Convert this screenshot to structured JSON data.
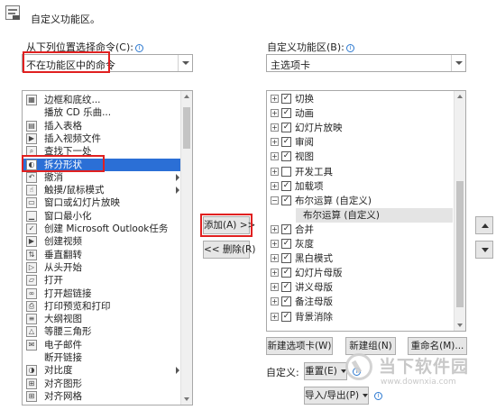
{
  "header": {
    "title": "自定义功能区。"
  },
  "left": {
    "label": "从下列位置选择命令(C):",
    "combo_value": "不在功能区中的命令",
    "commands": [
      {
        "label": "边框和底纹...",
        "icon": "borders-icon",
        "glyph": "▦"
      },
      {
        "label": "播放 CD 乐曲...",
        "icon": "blank-icon",
        "glyph": ""
      },
      {
        "label": "插入表格",
        "icon": "table-icon",
        "glyph": "▤"
      },
      {
        "label": "插入视频文件",
        "icon": "video-icon",
        "glyph": "▶"
      },
      {
        "label": "查找下一处",
        "icon": "find-icon",
        "glyph": "⌕"
      },
      {
        "label": "拆分形状",
        "icon": "split-shape-icon",
        "glyph": "◐",
        "selected": true
      },
      {
        "label": "撤消",
        "icon": "undo-icon",
        "glyph": "↶",
        "submenu": true
      },
      {
        "label": "触摸/鼠标模式",
        "icon": "touch-icon",
        "glyph": "☝",
        "submenu": true
      },
      {
        "label": "窗口或幻灯片放映",
        "icon": "window-icon",
        "glyph": "▭"
      },
      {
        "label": "窗口最小化",
        "icon": "minimize-icon",
        "glyph": "▁"
      },
      {
        "label": "创建 Microsoft Outlook任务",
        "icon": "outlook-icon",
        "glyph": "✓"
      },
      {
        "label": "创建视频",
        "icon": "create-video-icon",
        "glyph": "▶"
      },
      {
        "label": "垂直翻转",
        "icon": "flip-vertical-icon",
        "glyph": "⇅"
      },
      {
        "label": "从头开始",
        "icon": "from-start-icon",
        "glyph": "▷"
      },
      {
        "label": "打开",
        "icon": "open-folder-icon",
        "glyph": "▱"
      },
      {
        "label": "打开超链接",
        "icon": "hyperlink-icon",
        "glyph": "∞"
      },
      {
        "label": "打印预览和打印",
        "icon": "print-icon",
        "glyph": "⎙"
      },
      {
        "label": "大纲视图",
        "icon": "outline-icon",
        "glyph": "≡"
      },
      {
        "label": "等腰三角形",
        "icon": "triangle-icon",
        "glyph": "△"
      },
      {
        "label": "电子邮件",
        "icon": "email-icon",
        "glyph": "✉"
      },
      {
        "label": "断开链接",
        "icon": "blank-icon",
        "glyph": ""
      },
      {
        "label": "对比度",
        "icon": "contrast-icon",
        "glyph": "◑",
        "submenu": true
      },
      {
        "label": "对齐图形",
        "icon": "align-shape-icon",
        "glyph": "⊞"
      },
      {
        "label": "对齐网格",
        "icon": "align-grid-icon",
        "glyph": "⊞"
      }
    ]
  },
  "middle": {
    "add_button": "添加(A) >>",
    "remove_button": "<< 删除(R)"
  },
  "right": {
    "label": "自定义功能区(B):",
    "combo_value": "主选项卡",
    "tabs": [
      {
        "label": "切换",
        "checked": true,
        "expander": "+"
      },
      {
        "label": "动画",
        "checked": true,
        "expander": "+"
      },
      {
        "label": "幻灯片放映",
        "checked": true,
        "expander": "+"
      },
      {
        "label": "审阅",
        "checked": true,
        "expander": "+"
      },
      {
        "label": "视图",
        "checked": true,
        "expander": "+"
      },
      {
        "label": "开发工具",
        "checked": false,
        "expander": "+"
      },
      {
        "label": "加载项",
        "checked": true,
        "expander": "+"
      },
      {
        "label": "布尔运算 (自定义)",
        "checked": true,
        "expander": "−"
      },
      {
        "label": "布尔运算 (自定义)",
        "child": true,
        "highlighted": true
      },
      {
        "label": "合并",
        "checked": true,
        "expander": "+"
      },
      {
        "label": "灰度",
        "checked": true,
        "expander": "+"
      },
      {
        "label": "黑白模式",
        "checked": true,
        "expander": "+"
      },
      {
        "label": "幻灯片母版",
        "checked": true,
        "expander": "+"
      },
      {
        "label": "讲义母版",
        "checked": true,
        "expander": "+"
      },
      {
        "label": "备注母版",
        "checked": true,
        "expander": "+"
      },
      {
        "label": "背景消除",
        "checked": true,
        "expander": "+"
      }
    ],
    "new_tab_button": "新建选项卡(W)",
    "new_group_button": "新建组(N)",
    "rename_button": "重命名(M)...",
    "customize_label": "自定义:",
    "reset_button": "重置(E)",
    "import_export_button": "导入/导出(P)"
  },
  "watermark": {
    "name": "当下软件园",
    "url": "www.downxia.com"
  }
}
